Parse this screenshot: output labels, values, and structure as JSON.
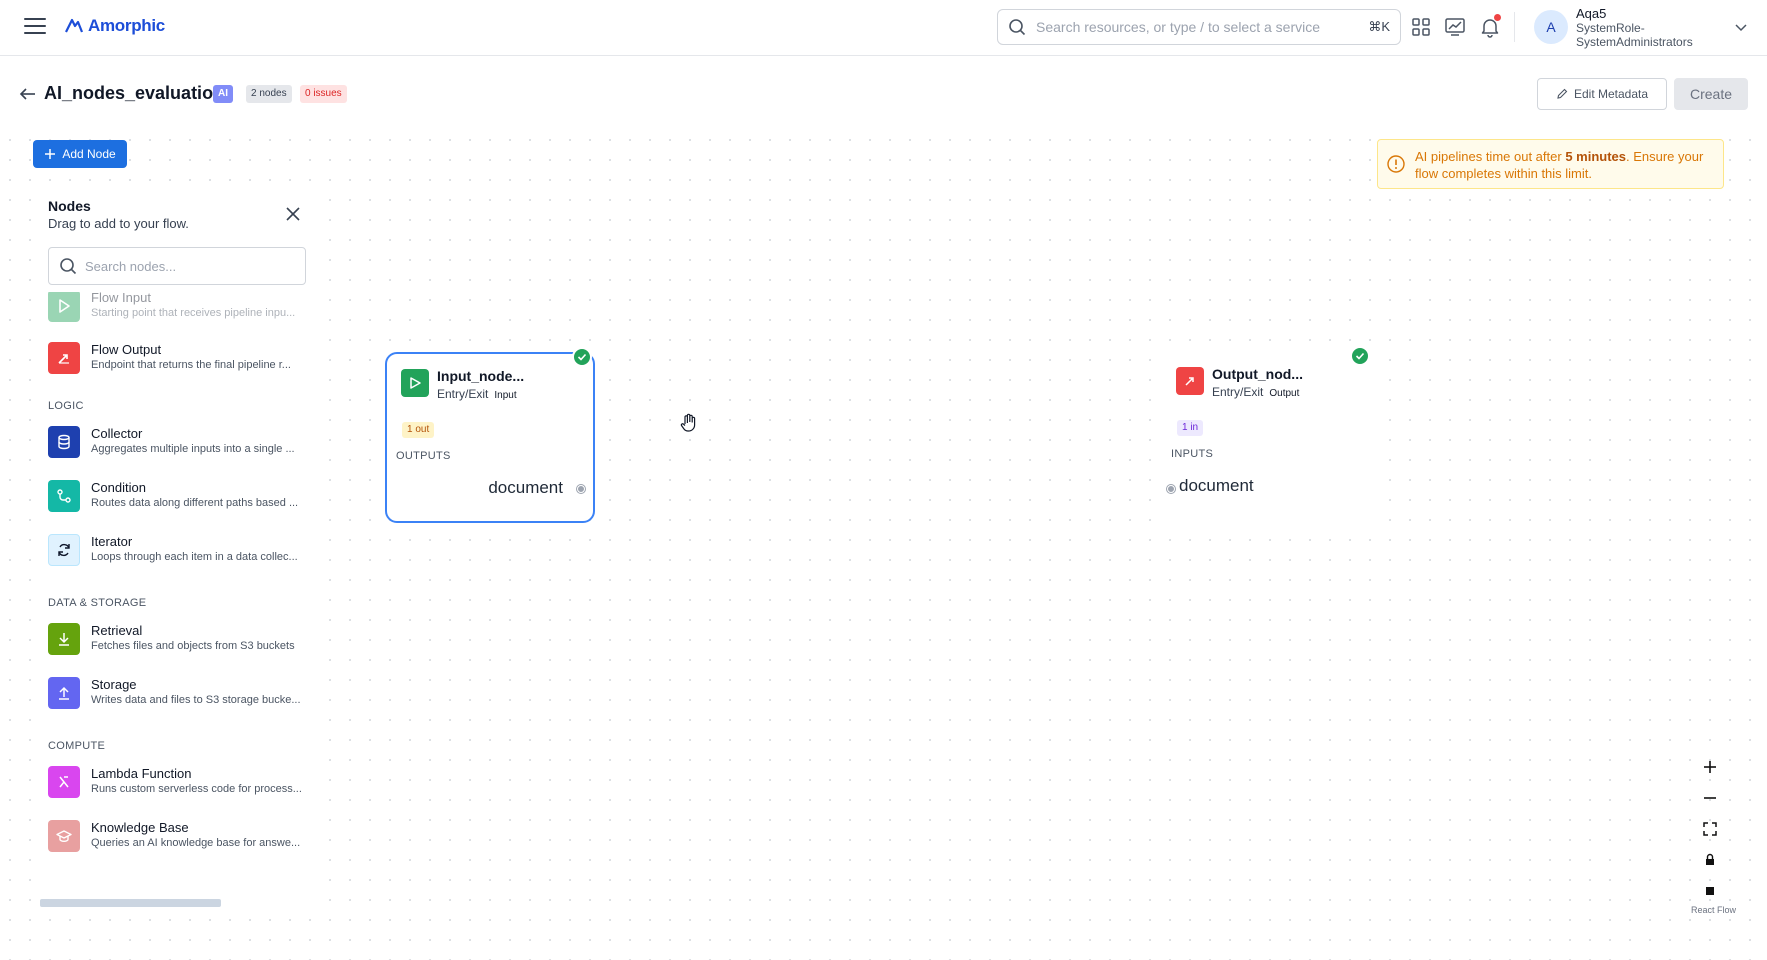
{
  "app": {
    "logo_text": "Amorphic",
    "brand_color": "#1d4ed8"
  },
  "header": {
    "search_placeholder": "Search resources, or type / to select a service",
    "search_shortcut": "⌘K",
    "icons": [
      "grid-icon",
      "monitor-chart-icon",
      "bell-icon"
    ],
    "user": {
      "initial": "A",
      "name": "Aqa5",
      "role_line1": "SystemRole-",
      "role_line2": "SystemAdministrators"
    }
  },
  "page": {
    "title": "AI_nodes_evaluation",
    "badge_type": "AI",
    "badge_nodes": "2 nodes",
    "badge_issues": "0 issues",
    "edit_label": "Edit Metadata",
    "create_label": "Create"
  },
  "canvas": {
    "add_node_label": "Add Node",
    "warning": {
      "prefix": "AI pipelines time out after ",
      "emphasis": "5 minutes",
      "suffix": ". Ensure your flow completes within this limit."
    },
    "attribution": "React Flow"
  },
  "panel": {
    "title": "Nodes",
    "subtitle": "Drag to add to your flow.",
    "search_placeholder": "Search nodes...",
    "entry_items": [
      {
        "name": "Flow Input",
        "desc": "Starting point that receives pipeline inpu...",
        "color": "#22a35a",
        "icon": "play-icon",
        "faded": true
      },
      {
        "name": "Flow Output",
        "desc": "Endpoint that returns the final pipeline r...",
        "color": "#ef4444",
        "icon": "export-icon"
      }
    ],
    "sections": [
      {
        "label": "LOGIC",
        "items": [
          {
            "name": "Collector",
            "desc": "Aggregates multiple inputs into a single ...",
            "color": "#1e40af",
            "icon": "database-icon"
          },
          {
            "name": "Condition",
            "desc": "Routes data along different paths based ...",
            "color": "#14b8a6",
            "icon": "branch-icon"
          },
          {
            "name": "Iterator",
            "desc": "Loops through each item in a data collec...",
            "color": "#bae6fd",
            "icon": "refresh-icon"
          }
        ]
      },
      {
        "label": "DATA & STORAGE",
        "items": [
          {
            "name": "Retrieval",
            "desc": "Fetches files and objects from S3 buckets",
            "color": "#65a30d",
            "icon": "download-icon"
          },
          {
            "name": "Storage",
            "desc": "Writes data and files to S3 storage bucke...",
            "color": "#6366f1",
            "icon": "upload-icon"
          }
        ]
      },
      {
        "label": "COMPUTE",
        "items": [
          {
            "name": "Lambda Function",
            "desc": "Runs custom serverless code for process...",
            "color": "#d946ef",
            "icon": "lambda-icon"
          },
          {
            "name": "Knowledge Base",
            "desc": "Queries an AI knowledge base for answe...",
            "color": "#e8a0a0",
            "icon": "graduation-cap-icon"
          }
        ]
      }
    ]
  },
  "flow_nodes": {
    "input": {
      "title": "Input_node...",
      "category": "Entry/Exit",
      "tag": "Input",
      "port_badge": "1 out",
      "section": "OUTPUTS",
      "port": "document"
    },
    "output": {
      "title": "Output_nod...",
      "category": "Entry/Exit",
      "tag": "Output",
      "port_badge": "1 in",
      "section": "INPUTS",
      "port": "document"
    }
  }
}
